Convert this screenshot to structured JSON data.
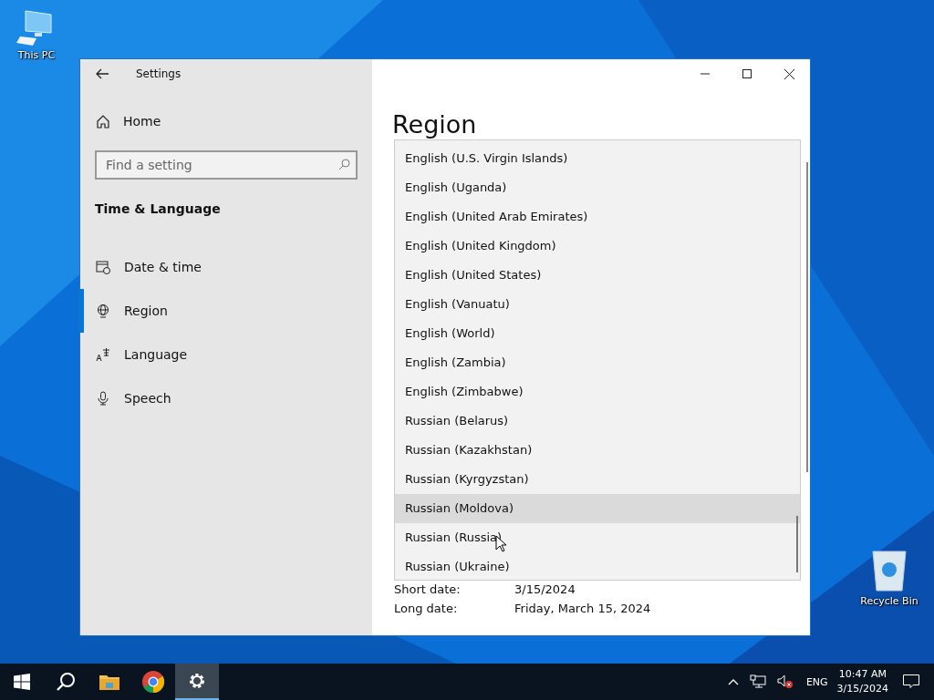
{
  "desktop_icons": [
    {
      "label": "This PC",
      "kind": "computer"
    },
    {
      "label": "Recycle Bin",
      "kind": "bin"
    }
  ],
  "window": {
    "title": "Settings"
  },
  "sidebar": {
    "home": "Home",
    "search": {
      "placeholder": "Find a setting"
    },
    "section": "Time & Language",
    "items": [
      {
        "label": "Date & time",
        "kind": "calendar",
        "selected": false
      },
      {
        "label": "Region",
        "kind": "globe",
        "selected": true
      },
      {
        "label": "Language",
        "kind": "language",
        "selected": false
      },
      {
        "label": "Speech",
        "kind": "mic",
        "selected": false
      }
    ]
  },
  "content": {
    "heading": "Region",
    "dropdown": {
      "items": [
        {
          "label": "English (U.S. Virgin Islands)",
          "highlighted": false
        },
        {
          "label": "English (Uganda)",
          "highlighted": false
        },
        {
          "label": "English (United Arab Emirates)",
          "highlighted": false
        },
        {
          "label": "English (United Kingdom)",
          "highlighted": false
        },
        {
          "label": "English (United States)",
          "highlighted": false
        },
        {
          "label": "English (Vanuatu)",
          "highlighted": false
        },
        {
          "label": "English (World)",
          "highlighted": false
        },
        {
          "label": "English (Zambia)",
          "highlighted": false
        },
        {
          "label": "English (Zimbabwe)",
          "highlighted": false
        },
        {
          "label": "Russian (Belarus)",
          "highlighted": false
        },
        {
          "label": "Russian (Kazakhstan)",
          "highlighted": false
        },
        {
          "label": "Russian (Kyrgyzstan)",
          "highlighted": false
        },
        {
          "label": "Russian (Moldova)",
          "highlighted": true
        },
        {
          "label": "Russian (Russia)",
          "highlighted": false
        },
        {
          "label": "Russian (Ukraine)",
          "highlighted": false
        }
      ]
    },
    "formats": [
      {
        "label": "Short date:",
        "value": "3/15/2024"
      },
      {
        "label": "Long date:",
        "value": "Friday, March 15, 2024"
      }
    ]
  },
  "taskbar": {
    "apps": [
      {
        "kind": "start",
        "selected": false
      },
      {
        "kind": "search",
        "selected": false
      },
      {
        "kind": "explorer",
        "selected": false
      },
      {
        "kind": "chrome",
        "selected": false
      },
      {
        "kind": "settings",
        "selected": true
      }
    ],
    "language": "ENG",
    "time": "10:47 AM",
    "date": "3/15/2024"
  }
}
